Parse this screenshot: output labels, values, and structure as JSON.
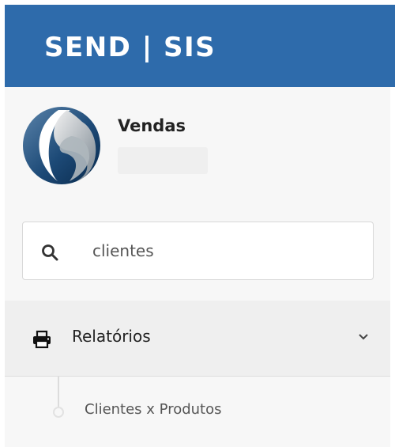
{
  "app": {
    "title": "SEND | SIS"
  },
  "user": {
    "name": "Vendas",
    "status": ""
  },
  "search": {
    "value": "clientes",
    "placeholder": ""
  },
  "menu": {
    "items": [
      {
        "label": "Relatórios",
        "icon": "print-icon",
        "expanded": true,
        "children": [
          {
            "label": "Clientes x Produtos"
          }
        ]
      }
    ]
  },
  "colors": {
    "topbar": "#2e6bab",
    "sidebar": "#f7f7f7",
    "active_item": "#efefef"
  }
}
